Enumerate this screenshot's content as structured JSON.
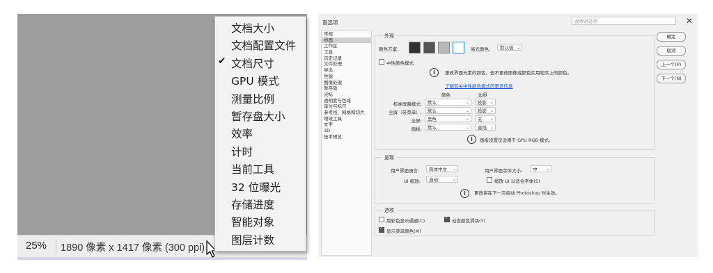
{
  "statusbar": {
    "zoom": "25%",
    "doc_info": "1890 像素 x 1417 像素 (300 ppi)",
    "arrow": "›"
  },
  "menu": {
    "items": [
      {
        "label": "文档大小",
        "checked": false
      },
      {
        "label": "文档配置文件",
        "checked": false
      },
      {
        "label": "文档尺寸",
        "checked": true
      },
      {
        "label": "GPU 模式",
        "checked": false
      },
      {
        "label": "测量比例",
        "checked": false
      },
      {
        "label": "暂存盘大小",
        "checked": false
      },
      {
        "label": "效率",
        "checked": false
      },
      {
        "label": "计时",
        "checked": false
      },
      {
        "label": "当前工具",
        "checked": false
      },
      {
        "label": "32 位曝光",
        "checked": false
      },
      {
        "label": "存储进度",
        "checked": false
      },
      {
        "label": "智能对象",
        "checked": false
      },
      {
        "label": "图层计数",
        "checked": false
      }
    ],
    "check_glyph": "✔"
  },
  "prefs": {
    "title": "首选项",
    "search_placeholder": "搜索首选项",
    "close": "✕",
    "sidebar": [
      "常规",
      "界面",
      "工作区",
      "工具",
      "历史记录",
      "文件处理",
      "导出",
      "性能",
      "图像处理",
      "暂存盘",
      "光标",
      "透明度与色域",
      "单位与标尺",
      "参考线、网格和切片",
      "增效工具",
      "文字",
      "3D",
      "技术预览"
    ],
    "sidebar_selected": 1,
    "appearance": {
      "group_title": "外观",
      "color_scheme_label": "颜色方案:",
      "swatches": [
        "#303030",
        "#535353",
        "#b8b8b8",
        "#ffffff"
      ],
      "selected_swatch": 3,
      "highlight_label": "高光颜色:",
      "highlight_value": "默认值",
      "neutral_mode_label": "中性颜色模式",
      "info_text": "更改界面元素的颜色，但不更改图像或颜色实用程序上的颜色。",
      "link_text": "了解有关中性颜色模式的更多信息",
      "col_color": "颜色",
      "col_border": "边界",
      "rows": [
        {
          "label": "标准屏幕模式:",
          "color": "默认",
          "border": "投影"
        },
        {
          "label": "全屏（带菜单）:",
          "color": "默认",
          "border": "投影"
        },
        {
          "label": "全屏:",
          "color": "黑色",
          "border": "无"
        },
        {
          "label": "画板:",
          "color": "默认",
          "border": "直线"
        }
      ],
      "artboard_note": "画板设置仅适用于 GPU RGB 模式。"
    },
    "presentation": {
      "group_title": "呈现",
      "ui_language_label": "用户界面语言:",
      "ui_language_value": "简体中文",
      "ui_font_size_label": "用户界面字体大小:",
      "ui_font_size_value": "中",
      "ui_scale_label": "UI 缩放:",
      "ui_scale_value": "自动",
      "scale_fonts_label": "缩放 UI 以适合字体(S)",
      "restart_note": "更改将在下一次启动 Photoshop 时生效。"
    },
    "options": {
      "group_title": "选项",
      "items": [
        {
          "label": "用彩色显示通道(C)",
          "checked": false
        },
        {
          "label": "动态颜色滑块(Y)",
          "checked": true
        },
        {
          "label": "显示菜单颜色(M)",
          "checked": true
        }
      ]
    },
    "buttons": {
      "ok": "确定",
      "cancel": "取消",
      "prev": "上一个(P)",
      "next": "下一个(N)"
    },
    "info_glyph": "i",
    "caret": "⌄"
  }
}
